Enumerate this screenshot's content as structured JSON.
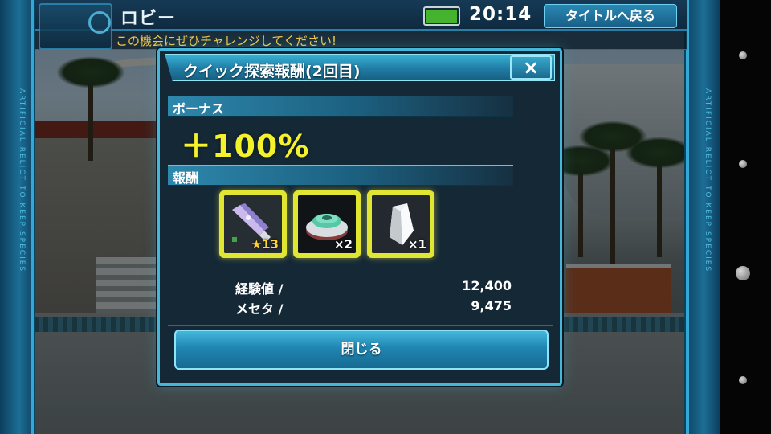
{
  "header": {
    "screen_title": "ロビー",
    "time": "20:14",
    "back_to_title_label": "タイトルへ戻る",
    "ticker": "この機会にぜひチャレンジしてください!",
    "frame_text": "ARTIFICIAL RELICT TO KEEP SPECIES"
  },
  "dialog": {
    "title": "クイック探索報酬(2回目)",
    "close_glyph": "×",
    "bonus": {
      "label": "ボーナス",
      "value": "＋100%"
    },
    "rewards": {
      "label": "報酬",
      "items": [
        {
          "icon": "weapon-icon",
          "badge": "★13"
        },
        {
          "icon": "disc-capsule-icon",
          "badge": "×2"
        },
        {
          "icon": "crystal-icon",
          "badge": "×1"
        }
      ]
    },
    "stats": [
      {
        "label": "経験値 /",
        "value": "12,400"
      },
      {
        "label": "メセタ /",
        "value": "9,475"
      }
    ],
    "close_button_label": "閉じる"
  },
  "colors": {
    "accent": "#46b7d8",
    "highlight_yellow": "#f4f22a",
    "item_frame": "#e0e631",
    "ticker_text": "#f2c94c",
    "battery_fill": "#46b32f"
  }
}
